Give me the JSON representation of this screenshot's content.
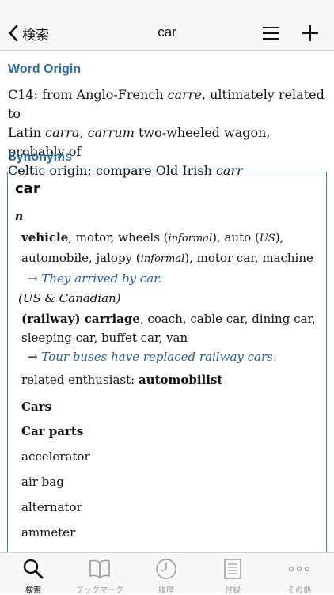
{
  "navbar": {
    "back_label": "検索",
    "title": "car"
  },
  "word_origin": {
    "heading": "Word Origin",
    "line1_a": "C14: from Anglo-French ",
    "line1_b": "carre",
    "line1_c": ", ultimately related to",
    "line2_a": "Latin ",
    "line2_b": "carra, carrum",
    "line2_c": " two-wheeled wagon, probably of",
    "line3_a": "Celtic origin; compare Old Irish ",
    "line3_b": "carr"
  },
  "synonyms": {
    "heading": "Synonyms",
    "headword": "car",
    "pos": "n",
    "sense1": {
      "l1_a": "vehicle",
      "l1_b": ", motor, wheels (",
      "l1_c": "informal",
      "l1_d": "), auto (",
      "l1_e": "US",
      "l1_f": "),",
      "l2_a": "automobile, jalopy (",
      "l2_b": "informal",
      "l2_c": "), motor car, machine",
      "arrow": "→",
      "example": "They arrived by car."
    },
    "register2": "(US & Canadian)",
    "sense2": {
      "l1_a": "(railway) carriage",
      "l1_b": ", coach, cable car, dining car,",
      "l2": "sleeping car, buffet car, van",
      "arrow": "→",
      "example": "Tour buses have replaced railway cars."
    },
    "related_label": "related enthusiast: ",
    "related_value": "automobilist",
    "cars_heading": "Cars",
    "parts_heading": "Car parts",
    "parts": [
      "accelerator",
      "air bag",
      "alternator",
      "ammeter"
    ]
  },
  "tabbar": {
    "tabs": [
      {
        "label": "検索",
        "icon": "search-icon"
      },
      {
        "label": "ブックマーク",
        "icon": "book-icon"
      },
      {
        "label": "履歴",
        "icon": "clock-icon"
      },
      {
        "label": "付録",
        "icon": "document-icon"
      },
      {
        "label": "その他",
        "icon": "more-icon"
      }
    ]
  }
}
